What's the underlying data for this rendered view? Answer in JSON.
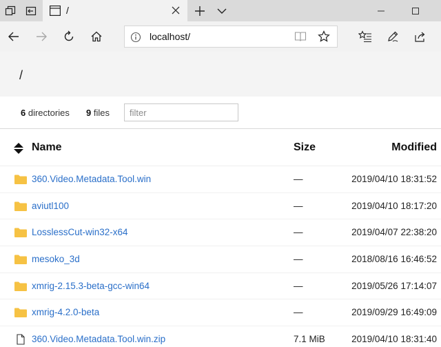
{
  "browser": {
    "tab_title": "/",
    "address": "localhost/"
  },
  "page": {
    "path": "/"
  },
  "summary": {
    "dir_count": "6",
    "dir_label": " directories",
    "file_count": "9",
    "file_label": " files",
    "filter_placeholder": "filter"
  },
  "table": {
    "col_name": "Name",
    "col_size": "Size",
    "col_modified": "Modified",
    "rows": [
      {
        "type": "folder",
        "name": "360.Video.Metadata.Tool.win",
        "size": "—",
        "modified": "2019/04/10 18:31:52"
      },
      {
        "type": "folder",
        "name": "aviutl100",
        "size": "—",
        "modified": "2019/04/10 18:17:20"
      },
      {
        "type": "folder",
        "name": "LosslessCut-win32-x64",
        "size": "—",
        "modified": "2019/04/07 22:38:20"
      },
      {
        "type": "folder",
        "name": "mesoko_3d",
        "size": "—",
        "modified": "2018/08/16 16:46:52"
      },
      {
        "type": "folder",
        "name": "xmrig-2.15.3-beta-gcc-win64",
        "size": "—",
        "modified": "2019/05/26 17:14:07"
      },
      {
        "type": "folder",
        "name": "xmrig-4.2.0-beta",
        "size": "—",
        "modified": "2019/09/29 16:49:09"
      },
      {
        "type": "file",
        "name": "360.Video.Metadata.Tool.win.zip",
        "size": "7.1 MiB",
        "modified": "2019/04/10 18:31:40"
      }
    ]
  },
  "colors": {
    "link": "#2a6fc9",
    "folder": "#f6c244",
    "header_bg": "#f4f4f4"
  },
  "icons": {
    "folder": "folder-icon",
    "file": "file-icon",
    "sort": "sort-icon"
  }
}
